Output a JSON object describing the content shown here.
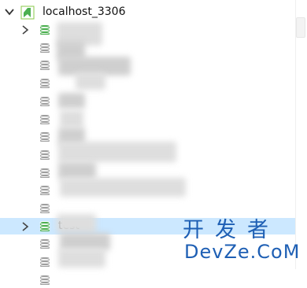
{
  "tree": {
    "root": {
      "label": "localhost_3306",
      "expanded": true,
      "icon": "mysql-server-icon"
    },
    "databases": [
      {
        "label": "",
        "obscured": true,
        "open": true,
        "expandable": true
      },
      {
        "label": "",
        "obscured": true,
        "open": false,
        "expandable": false
      },
      {
        "label": "",
        "obscured": true,
        "open": false,
        "expandable": false
      },
      {
        "label": "",
        "obscured": true,
        "open": false,
        "expandable": false
      },
      {
        "label": "",
        "obscured": true,
        "open": false,
        "expandable": false
      },
      {
        "label": "",
        "obscured": true,
        "open": false,
        "expandable": false
      },
      {
        "label": "",
        "obscured": true,
        "open": false,
        "expandable": false
      },
      {
        "label": "",
        "obscured": true,
        "open": false,
        "expandable": false
      },
      {
        "label": "",
        "obscured": true,
        "open": false,
        "expandable": false
      },
      {
        "label": "",
        "obscured": true,
        "open": false,
        "expandable": false
      },
      {
        "label": "",
        "obscured": true,
        "open": false,
        "expandable": false
      },
      {
        "label": "test",
        "obscured": false,
        "open": true,
        "expandable": true,
        "selected": true
      },
      {
        "label": "",
        "obscured": true,
        "open": false,
        "expandable": false
      },
      {
        "label": "",
        "obscured": true,
        "open": false,
        "expandable": false
      },
      {
        "label": "",
        "obscured": true,
        "open": false,
        "expandable": false
      }
    ]
  },
  "watermark": {
    "line1": "开发者",
    "line2": "DevZe.CoM"
  },
  "colors": {
    "selection": "#cce8ff",
    "db_open": "#4caf50",
    "db_closed": "#9e9e9e",
    "watermark": "#1e5fb4"
  }
}
